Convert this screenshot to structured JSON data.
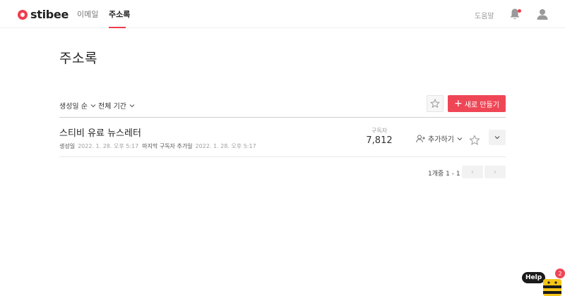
{
  "header": {
    "logo_text": "stibee",
    "nav": [
      {
        "label": "이메일"
      },
      {
        "label": "주소록"
      }
    ],
    "help_label": "도움말"
  },
  "page": {
    "title": "주소록"
  },
  "filters": {
    "sort_label": "생성일 순",
    "period_label": "전체 기간"
  },
  "actions": {
    "new_label": "새로 만들기"
  },
  "list": {
    "name": "스티비 유료 뉴스레터",
    "created_label": "생성일",
    "created_value": "2022. 1. 28. 오후 5:17",
    "last_added_label": "마지막 구독자 추가일",
    "last_added_value": "2022. 1. 28. 오후 5:17",
    "subscribers_label": "구독자",
    "subscribers_count": "7,812",
    "add_label": "추가하기"
  },
  "pagination": {
    "text": "1개중 1 - 1",
    "prev_icon": "‹",
    "next_icon": "›"
  },
  "help_widget": {
    "label": "Help",
    "badge": "2"
  },
  "colors": {
    "accent": "#ef4656",
    "text": "#222222"
  }
}
